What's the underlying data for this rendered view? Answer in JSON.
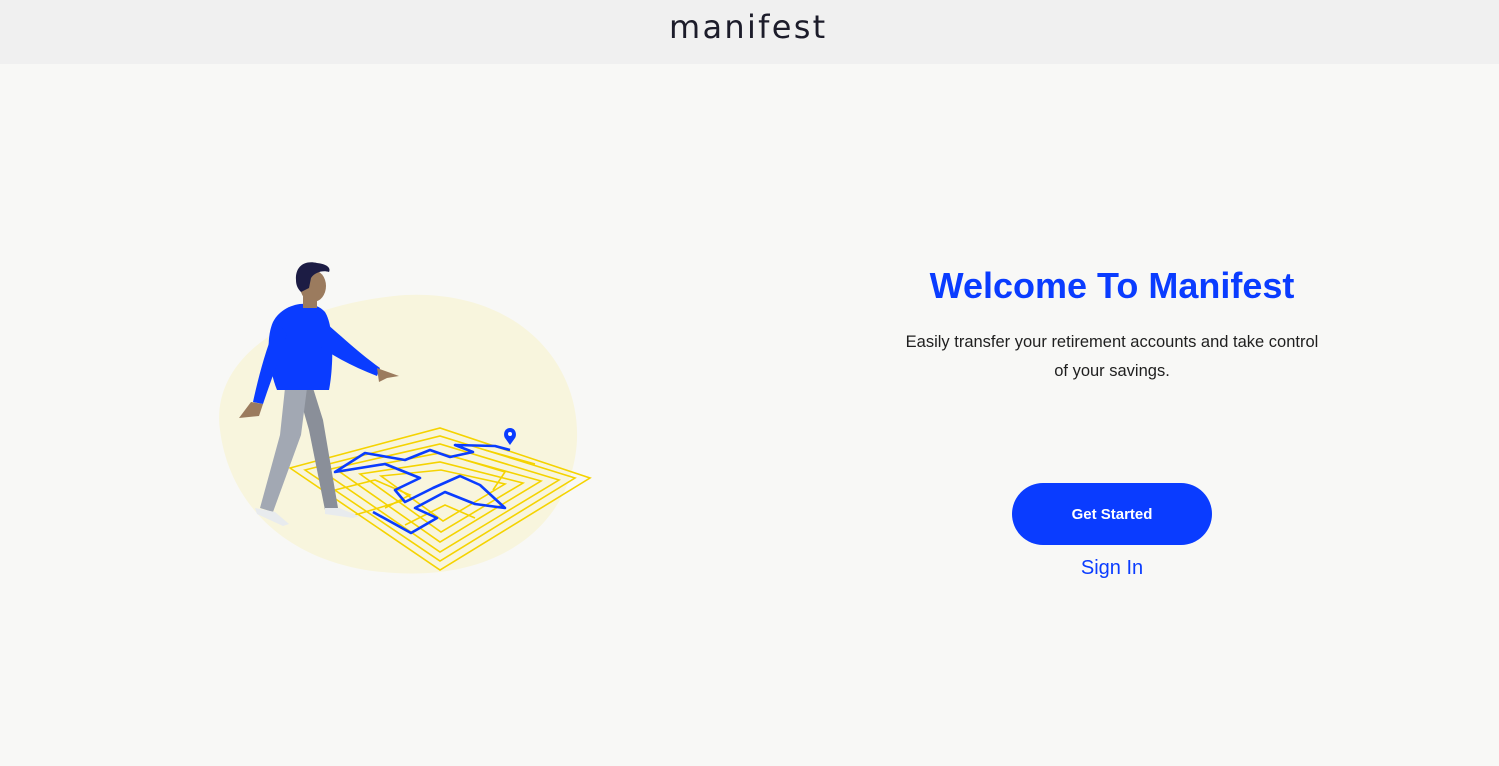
{
  "header": {
    "logo_text": "manifest",
    "logo_accent_color": "#0a3cff"
  },
  "hero": {
    "illustration_icon": "person-walking-maze-illustration",
    "title": "Welcome To Manifest",
    "subtitle": "Easily transfer your retirement accounts and take control of your savings.",
    "primary_button_label": "Get Started",
    "secondary_link_label": "Sign In"
  },
  "colors": {
    "accent": "#0a3cff",
    "header_bg": "#f0f0f0",
    "page_bg": "#f8f8f6",
    "maze_yellow": "#f5d300",
    "blob_yellow": "#f8f5dd"
  }
}
